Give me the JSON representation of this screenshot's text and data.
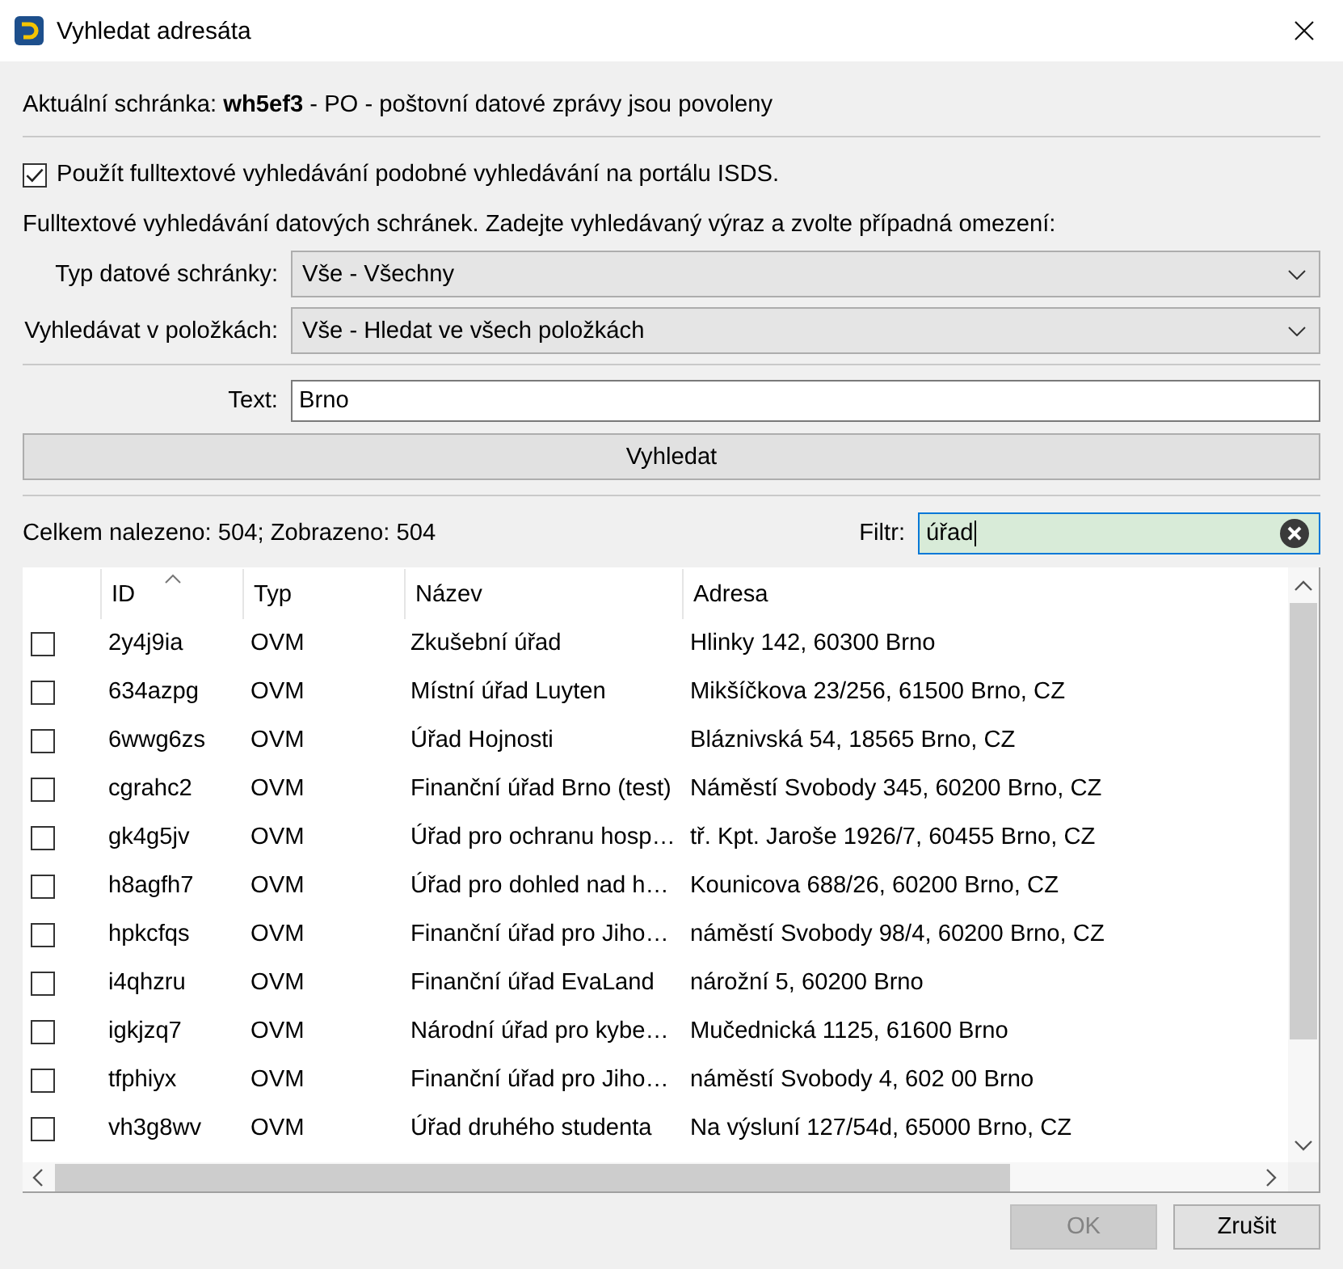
{
  "window": {
    "title": "Vyhledat adresáta"
  },
  "current_box": "Aktuální schránka: **wh5ef3** - PO - poštovní datové zprávy jsou povoleny",
  "fulltext_checkbox": {
    "label": "Použít fulltextové vyhledávání podobné vyhledávání na portálu ISDS.",
    "checked": true
  },
  "instructions": "Fulltextové vyhledávání datových schránek. Zadejte vyhledávaný výraz a zvolte případná omezení:",
  "dropdowns": [
    {
      "label": "Typ datové schránky:",
      "value": "Vše - Všechny"
    },
    {
      "label": "Vyhledávat v položkách:",
      "value": "Vše - Hledat ve všech položkách"
    }
  ],
  "text_field": {
    "label": "Text:",
    "value": "Brno"
  },
  "search_button": "Vyhledat",
  "summary": "Celkem nalezeno: 504; Zobrazeno: 504",
  "filter_field": {
    "label": "Filtr:",
    "value": "úřad"
  },
  "table": {
    "columns": [
      {
        "label": "ID",
        "sorted": true
      },
      {
        "label": "Typ",
        "sorted": false
      },
      {
        "label": "Název",
        "sorted": false
      },
      {
        "label": "Adresa",
        "sorted": false
      }
    ],
    "rows": [
      {
        "checked": false,
        "cells": [
          "2y4j9ia",
          "OVM",
          "Zkušební úřad",
          "Hlinky 142, 60300 Brno"
        ]
      },
      {
        "checked": false,
        "cells": [
          "634azpg",
          "OVM",
          "Místní úřad Luyten",
          "Mikšíčkova 23/256, 61500 Brno, CZ"
        ]
      },
      {
        "checked": false,
        "cells": [
          "6wwg6zs",
          "OVM",
          "Úřad Hojnosti",
          "Bláznivská 54, 18565 Brno, CZ"
        ]
      },
      {
        "checked": false,
        "cells": [
          "cgrahc2",
          "OVM",
          "Finanční úřad Brno (test)",
          "Náměstí Svobody 345, 60200 Brno, CZ"
        ]
      },
      {
        "checked": false,
        "cells": [
          "gk4g5jv",
          "OVM",
          "Úřad pro ochranu hosp…",
          "tř. Kpt. Jaroše 1926/7, 60455 Brno, CZ"
        ]
      },
      {
        "checked": false,
        "cells": [
          "h8agfh7",
          "OVM",
          "Úřad pro dohled nad h…",
          "Kounicova 688/26, 60200 Brno, CZ"
        ]
      },
      {
        "checked": false,
        "cells": [
          "hpkcfqs",
          "OVM",
          "Finanční úřad pro Jiho…",
          "náměstí Svobody 98/4, 60200 Brno, CZ"
        ]
      },
      {
        "checked": false,
        "cells": [
          "i4qhzru",
          "OVM",
          "Finanční úřad EvaLand",
          "nárožní 5, 60200 Brno"
        ]
      },
      {
        "checked": false,
        "cells": [
          "igkjzq7",
          "OVM",
          "Národní úřad pro kybe…",
          "Mučednická 1125, 61600 Brno"
        ]
      },
      {
        "checked": false,
        "cells": [
          "tfphiyx",
          "OVM",
          "Finanční úřad pro Jiho…",
          "náměstí Svobody 4, 602 00 Brno"
        ]
      },
      {
        "checked": false,
        "cells": [
          "vh3g8wv",
          "OVM",
          "Úřad druhého studenta",
          "Na výsluní 127/54d, 65000 Brno, CZ"
        ]
      }
    ]
  },
  "buttons": [
    {
      "label": "OK",
      "disabled": true
    },
    {
      "label": "Zrušit",
      "disabled": false
    }
  ]
}
